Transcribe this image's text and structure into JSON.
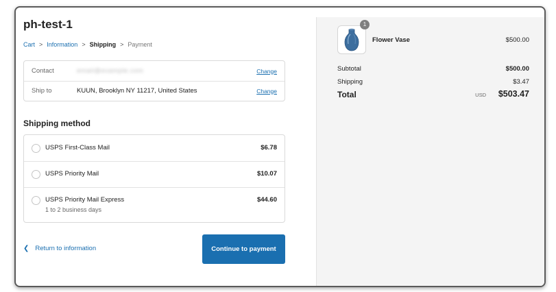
{
  "store": {
    "title": "ph-test-1"
  },
  "breadcrumb": {
    "items": [
      {
        "label": "Cart"
      },
      {
        "label": "Information"
      },
      {
        "label": "Shipping"
      },
      {
        "label": "Payment"
      }
    ]
  },
  "review": {
    "contact": {
      "label": "Contact",
      "value": "email@example.com",
      "action": "Change"
    },
    "ship_to": {
      "label": "Ship to",
      "value": "KUUN, Brooklyn NY 11217, United States",
      "action": "Change"
    }
  },
  "shipping_method": {
    "title": "Shipping method",
    "options": [
      {
        "name": "USPS First-Class Mail",
        "subtext": "",
        "price": "$6.78"
      },
      {
        "name": "USPS Priority Mail",
        "subtext": "",
        "price": "$10.07"
      },
      {
        "name": "USPS Priority Mail Express",
        "subtext": "1 to 2 business days",
        "price": "$44.60"
      }
    ]
  },
  "actions": {
    "return_label": "Return to information",
    "continue_label": "Continue to payment"
  },
  "order_summary": {
    "product": {
      "name": "Flower Vase",
      "price": "$500.00",
      "quantity": "1"
    },
    "subtotal": {
      "label": "Subtotal",
      "value": "$500.00"
    },
    "shipping": {
      "label": "Shipping",
      "value": "$3.47"
    },
    "total": {
      "label": "Total",
      "currency": "USD",
      "value": "$503.47"
    }
  },
  "colors": {
    "accent": "#1a6fb0",
    "summary_bg": "#f4f4f4",
    "vase": "#3d6e9e"
  }
}
